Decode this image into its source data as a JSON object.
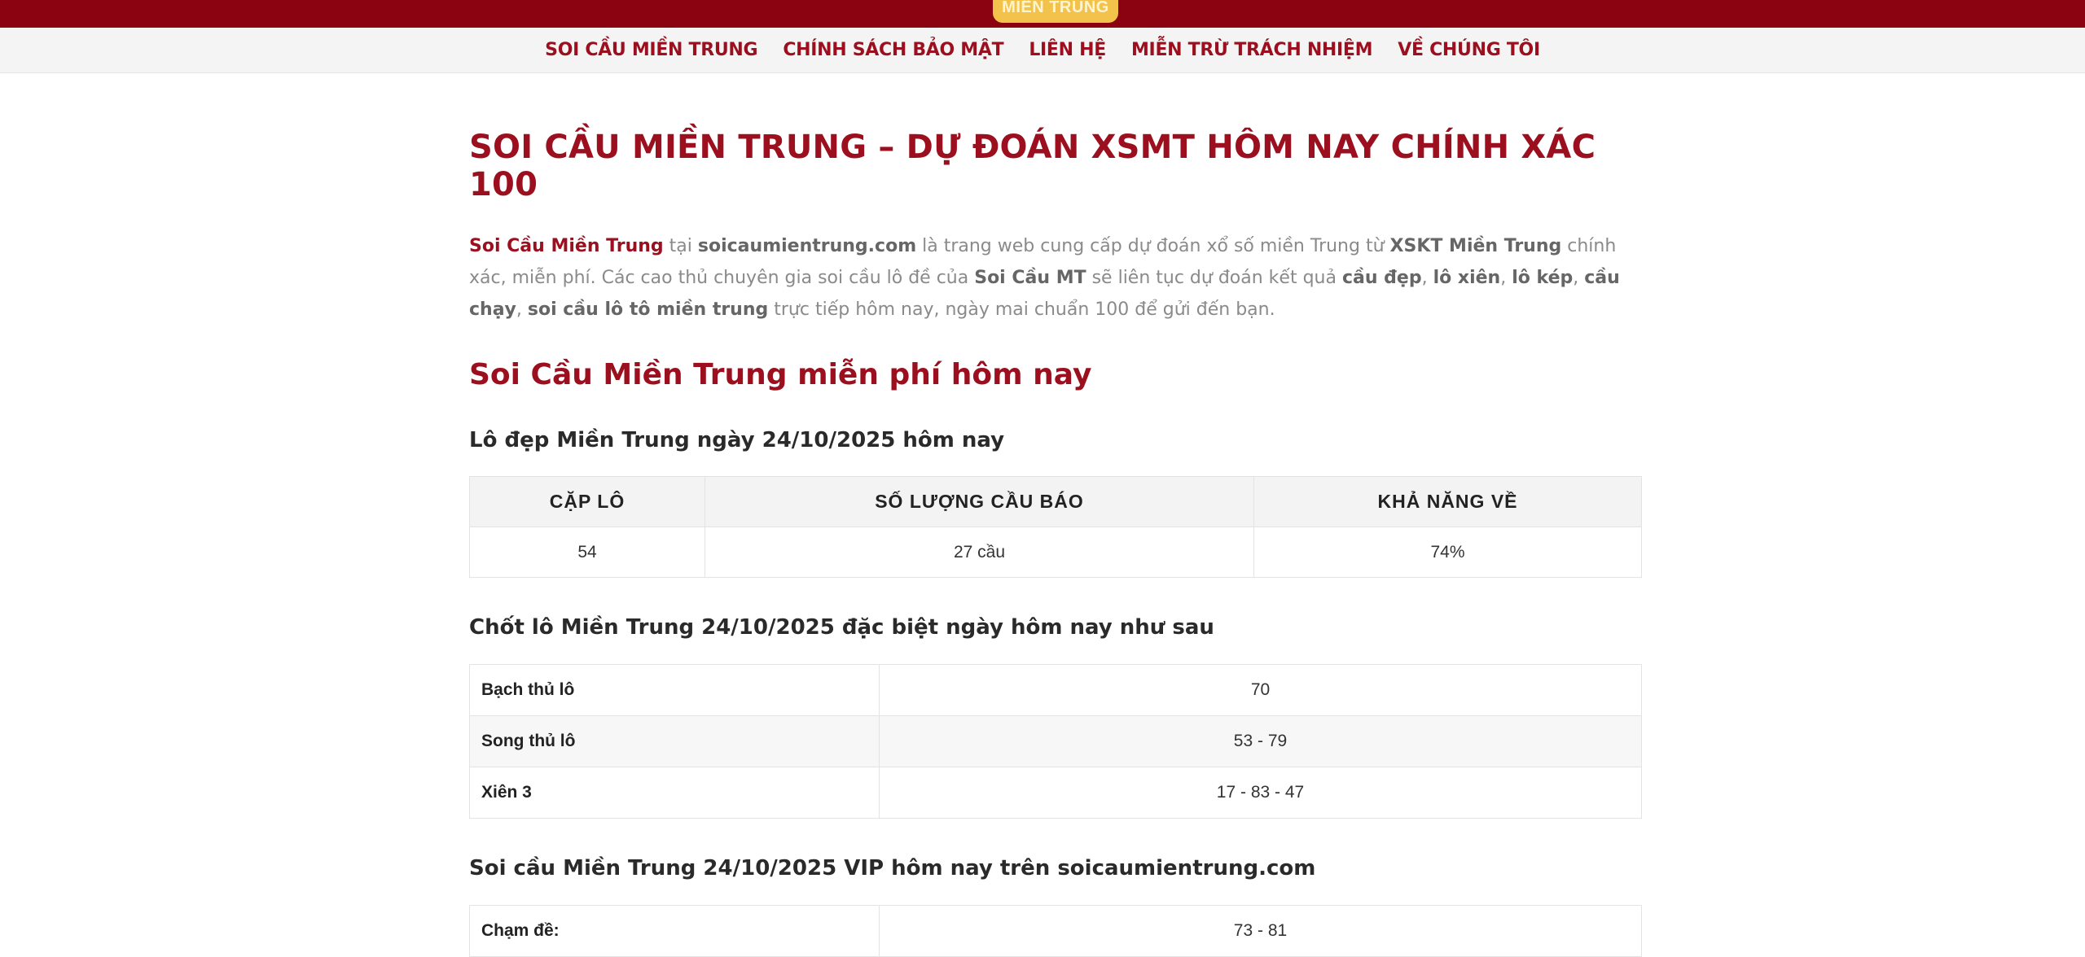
{
  "logo": {
    "text": "MIỀN TRUNG"
  },
  "nav": {
    "items": [
      "SOI CẦU MIỀN TRUNG",
      "CHÍNH SÁCH BẢO MẬT",
      "LIÊN HỆ",
      "MIỄN TRỪ TRÁCH NHIỆM",
      "VỀ CHÚNG TÔI"
    ]
  },
  "page": {
    "title": "SOI CẦU MIỀN TRUNG – DỰ ĐOÁN XSMT HÔM NAY CHÍNH XÁC 100",
    "intro": {
      "p1": "Soi Cầu Miền Trung",
      "p2": " tại ",
      "p3": "soicaumientrung.com",
      "p4": " là trang web cung cấp dự đoán xổ số miền Trung từ ",
      "p5": "XSKT Miền Trung",
      "p6": " chính xác, miễn phí. Các cao thủ chuyên gia soi cầu lô đề của ",
      "p7": "Soi Cầu MT",
      "p8": " sẽ liên tục dự đoán kết quả ",
      "p9": "cầu đẹp",
      "p10": ", ",
      "p11": "lô xiên",
      "p12": ", ",
      "p13": "lô kép",
      "p14": ", ",
      "p15": "cầu chạy",
      "p16": ", ",
      "p17": "soi cầu lô tô miền trung",
      "p18": " trực tiếp hôm nay, ngày mai chuẩn 100 để gửi đến bạn."
    },
    "section_title": "Soi Cầu Miền Trung miễn phí hôm nay"
  },
  "lo_dep": {
    "heading": "Lô đẹp Miền Trung ngày 24/10/2025 hôm nay",
    "headers": [
      "CẶP LÔ",
      "SỐ LƯỢNG CẦU BÁO",
      "KHẢ NĂNG VỀ"
    ],
    "row": [
      "54",
      "27 cầu",
      "74%"
    ]
  },
  "chot_lo": {
    "heading": "Chốt lô Miền Trung 24/10/2025 đặc biệt ngày hôm nay như sau",
    "rows": [
      {
        "label": "Bạch thủ lô",
        "value": "70"
      },
      {
        "label": "Song thủ lô",
        "value": "53 - 79"
      },
      {
        "label": "Xiên 3",
        "value": "17 - 83 - 47"
      }
    ]
  },
  "vip": {
    "heading": "Soi cầu Miền Trung 24/10/2025 VIP hôm nay trên soicaumientrung.com",
    "rows": [
      {
        "label": "Chạm đề:",
        "value": "73 - 81"
      }
    ]
  }
}
